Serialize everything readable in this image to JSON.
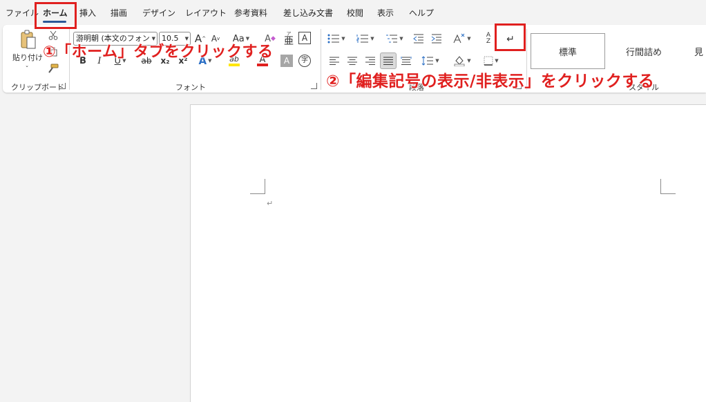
{
  "tabs": [
    "ファイル",
    "ホーム",
    "挿入",
    "描画",
    "デザイン",
    "レイアウト",
    "参考資料",
    "差し込み文書",
    "校閲",
    "表示",
    "ヘルプ"
  ],
  "clipboard": {
    "paste_label": "貼り付け",
    "group_label": "クリップボード"
  },
  "font": {
    "family_value": "游明朝 (本文のフォン",
    "size_value": "10.5",
    "bold": "B",
    "italic": "I",
    "underline": "U",
    "strike": "ab",
    "subscript": "x₂",
    "superscript": "x²",
    "effects": "A",
    "highlight": "ab",
    "font_color": "A",
    "shade": "A",
    "grow": "A",
    "shrink": "A",
    "case": "Aa",
    "clear": "A",
    "phonetic": "ア",
    "border_char": "A",
    "enclose": "字",
    "group_label": "フォント"
  },
  "paragraph": {
    "group_label": "段落",
    "sort_top": "A",
    "sort_bottom": "Z",
    "edit_mark_glyph": "↵"
  },
  "styles": {
    "items": [
      "標準",
      "行間詰め",
      "見"
    ],
    "group_label": "スタイル"
  },
  "document": {
    "paragraph_mark": "↵"
  },
  "annotations": {
    "step1": "①「ホーム」タブをクリックする",
    "step2": "②「編集記号の表示/非表示」をクリックする"
  },
  "colors": {
    "accent_tab": "#2b5797",
    "annotation_red": "#e0201f",
    "highlight_yellow": "#ffe600",
    "font_color_red": "#e0201f"
  }
}
